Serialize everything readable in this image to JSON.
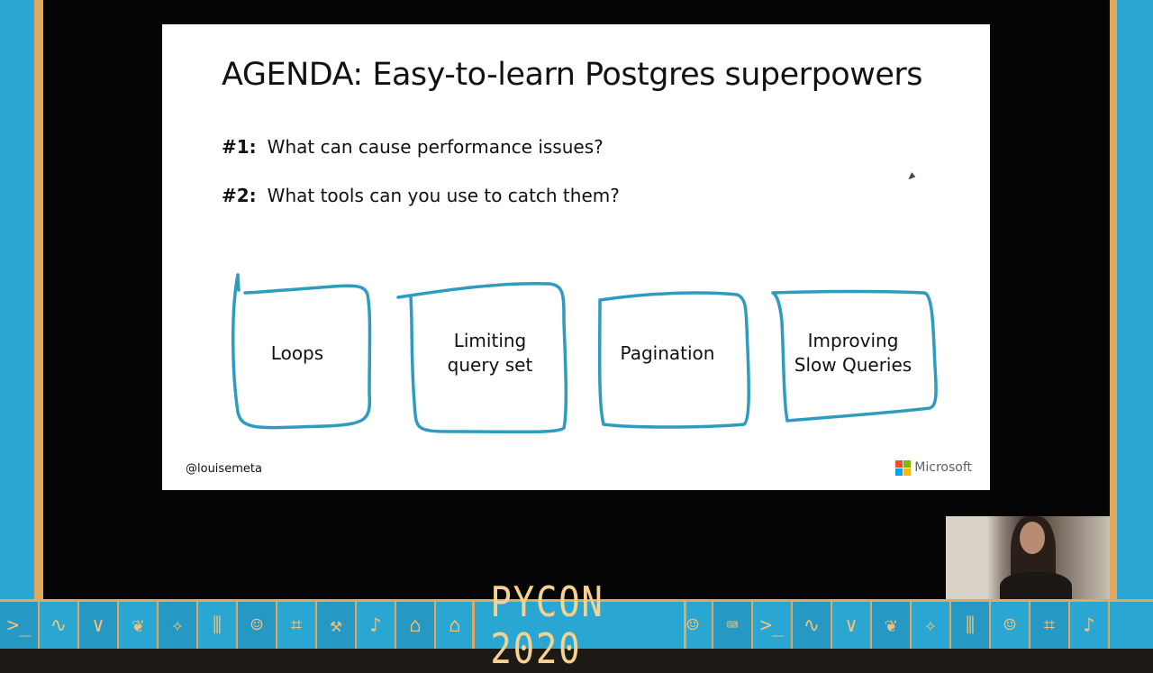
{
  "slide": {
    "title": "AGENDA: Easy-to-learn Postgres superpowers",
    "items": [
      {
        "num": "#1:",
        "text": "What can cause performance issues?"
      },
      {
        "num": "#2:",
        "text": "What tools can you use to catch them?"
      }
    ],
    "boxes": [
      {
        "line1": "Loops",
        "line2": ""
      },
      {
        "line1": "Limiting",
        "line2": "query set"
      },
      {
        "line1": "Pagination",
        "line2": ""
      },
      {
        "line1": "Improving",
        "line2": "Slow Queries"
      }
    ],
    "box_color": "#2e9cc0",
    "handle": "@louisemeta",
    "brand": "Microsoft"
  },
  "banner": {
    "logo_text": "PYCON 2020",
    "background": "#2aa6d3",
    "accent": "#e0a95e",
    "left_tiles": [
      "terminal-icon",
      "snake-icon",
      "chevron-icon",
      "leaf-icon",
      "star-icon",
      "tower-icon",
      "robot-icon",
      "circuit-icon",
      "tool-icon",
      "harp-icon",
      "building-icon"
    ],
    "right_tiles": [
      "building-icon",
      "robot-icon",
      "laptop-icon",
      "terminal-icon",
      "snake-icon",
      "chevron-icon",
      "leaf-icon",
      "star-icon",
      "tower-icon",
      "robot-icon"
    ]
  }
}
